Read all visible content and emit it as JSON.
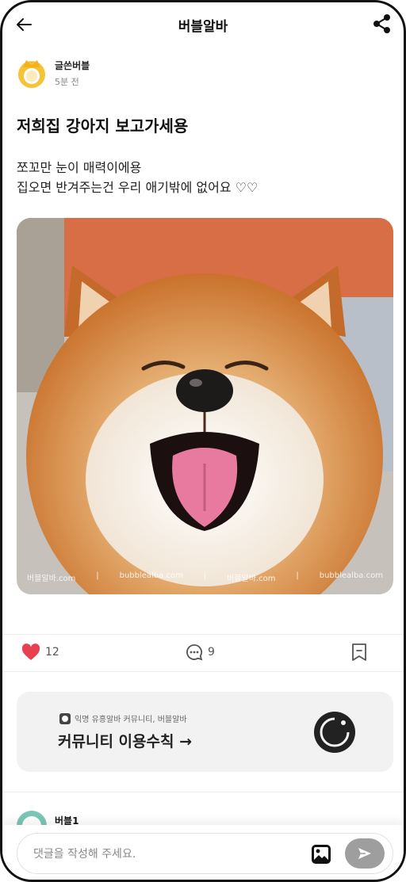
{
  "header": {
    "title": "버블알바",
    "back_icon": "arrow-left-icon",
    "share_icon": "share-icon"
  },
  "post": {
    "author": "글쓴버블",
    "time": "5분 전",
    "title": "저희집 강아지 보고가세용",
    "body_line1": "쪼꼬만 눈이 매력이에용",
    "body_line2": "집오면 반겨주는건 우리 애기밖에 없어요 ♡♡",
    "image_watermark": [
      "버블알바.com",
      "|",
      "bubblealba.com",
      "|",
      "버블알바.com",
      "|",
      "bubblealba.com"
    ]
  },
  "actions": {
    "like_count": "12",
    "comment_count": "9",
    "like_color": "#e8404f"
  },
  "banner": {
    "subtitle": "익명 유흥알바 커뮤니티, 버블알바",
    "label": "커뮤니티 이용수칙 →"
  },
  "comment_preview": {
    "name": "버블1"
  },
  "composer": {
    "placeholder": "댓글을 작성해 주세요.",
    "image_icon": "image-icon",
    "send_icon": "send-icon"
  }
}
